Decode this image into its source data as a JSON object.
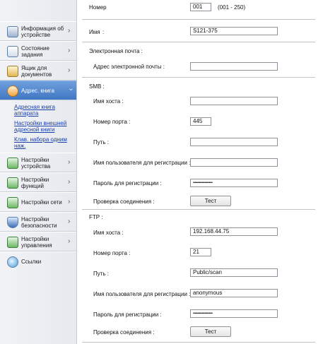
{
  "sidebar": {
    "items": [
      {
        "label": "Информация об устройстве",
        "icon": "device-info-icon"
      },
      {
        "label": "Состояние задания",
        "icon": "job-status-icon"
      },
      {
        "label": "Ящик для документов",
        "icon": "document-box-icon"
      },
      {
        "label": "Адрес. книга",
        "icon": "address-book-icon"
      },
      {
        "label": "Настройки устройства",
        "icon": "device-settings-icon"
      },
      {
        "label": "Настройки функций",
        "icon": "function-settings-icon"
      },
      {
        "label": "Настройки сети",
        "icon": "network-settings-icon"
      },
      {
        "label": "Настройки безопасности",
        "icon": "security-settings-icon"
      },
      {
        "label": "Настройки управления",
        "icon": "management-settings-icon"
      },
      {
        "label": "Ссылки",
        "icon": "links-icon"
      }
    ],
    "sublinks": [
      "Адресная книга аппарата",
      "Настройки внешней адресной книги",
      "Клав. набора одним наж."
    ]
  },
  "form": {
    "number": {
      "label": "Номер",
      "value": "001",
      "range": "(001  -  250)"
    },
    "name": {
      "label": "Имя",
      "value": "S121-375"
    },
    "email": {
      "section": "Электронная почта :",
      "address_label": "Адрес электронной почты :",
      "address_value": ""
    },
    "smb": {
      "section": "SMB :",
      "host_label": "Имя хоста :",
      "host_value": "",
      "port_label": "Номер порта :",
      "port_value": "445",
      "path_label": "Путь :",
      "path_value": "",
      "user_label": "Имя пользователя для регистрации :",
      "user_value": "",
      "password_label": "Пароль для регистрации :",
      "password_value": "••••••••••••••••••••••",
      "test_label": "Проверка соединения :",
      "test_button": "Тест"
    },
    "ftp": {
      "section": "FTP :",
      "host_label": "Имя хоста :",
      "host_value": "192.168.44.75",
      "port_label": "Номер порта :",
      "port_value": "21",
      "path_label": "Путь :",
      "path_value": "Public/scan",
      "user_label": "Имя пользователя для регистрации :",
      "user_value": "anonymous",
      "password_label": "Пароль для регистрации :",
      "password_value": "••••••••••••••••••••••",
      "test_label": "Проверка соединения :",
      "test_button": "Тест"
    }
  },
  "colors": {
    "active_nav": "#4a80cc",
    "link": "#1b3fa8"
  }
}
